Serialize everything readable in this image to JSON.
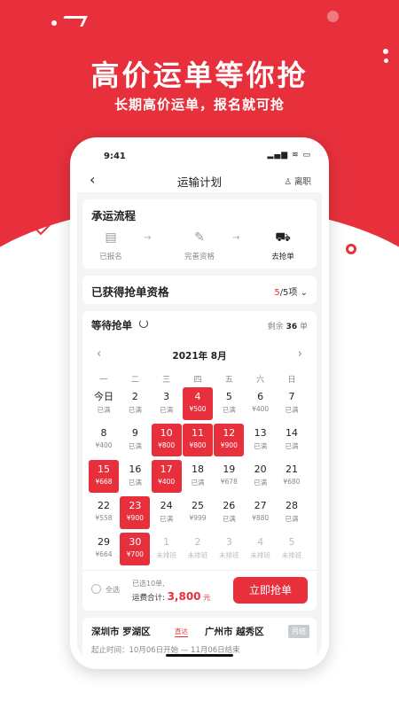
{
  "promo": {
    "title": "高价运单等你抢",
    "subtitle": "长期高价运单，报名就可抢"
  },
  "status_bar": {
    "time": "9:41",
    "icons": "▂▄▆ ≋ ▭"
  },
  "nav": {
    "back_icon": "‹",
    "title": "运输计划",
    "resign_label": "♙ 离职"
  },
  "flow": {
    "title": "承运流程",
    "steps": [
      {
        "label": "已报名",
        "icon": "▤"
      },
      {
        "label": "完善资格",
        "icon": "✎"
      },
      {
        "label": "去抢单",
        "icon": "⛟"
      }
    ],
    "arrow": "→"
  },
  "qualification": {
    "title": "已获得抢单资格",
    "count": "5",
    "total_suffix": "/5项",
    "chevron": "⌄"
  },
  "calendar": {
    "title": "等待抢单",
    "remain_prefix": "剩余",
    "remain_count": "36",
    "remain_suffix": "单",
    "month": "2021年 8月",
    "prev": "‹",
    "next": "›",
    "weekdays": [
      "一",
      "二",
      "三",
      "四",
      "五",
      "六",
      "日"
    ],
    "days": [
      {
        "d": "今日",
        "s": "已满",
        "state": "normal"
      },
      {
        "d": "2",
        "s": "已满",
        "state": "normal"
      },
      {
        "d": "3",
        "s": "已满",
        "state": "normal"
      },
      {
        "d": "4",
        "s": "¥500",
        "state": "sel"
      },
      {
        "d": "5",
        "s": "已满",
        "state": "normal"
      },
      {
        "d": "6",
        "s": "¥400",
        "state": "normal"
      },
      {
        "d": "7",
        "s": "已满",
        "state": "normal"
      },
      {
        "d": "8",
        "s": "¥400",
        "state": "normal"
      },
      {
        "d": "9",
        "s": "已满",
        "state": "normal"
      },
      {
        "d": "10",
        "s": "¥800",
        "state": "sel"
      },
      {
        "d": "11",
        "s": "¥800",
        "state": "sel"
      },
      {
        "d": "12",
        "s": "¥900",
        "state": "sel"
      },
      {
        "d": "13",
        "s": "已满",
        "state": "normal"
      },
      {
        "d": "14",
        "s": "已满",
        "state": "normal"
      },
      {
        "d": "15",
        "s": "¥668",
        "state": "sel"
      },
      {
        "d": "16",
        "s": "已满",
        "state": "normal"
      },
      {
        "d": "17",
        "s": "¥400",
        "state": "sel"
      },
      {
        "d": "18",
        "s": "已满",
        "state": "normal"
      },
      {
        "d": "19",
        "s": "¥678",
        "state": "normal"
      },
      {
        "d": "20",
        "s": "已满",
        "state": "normal"
      },
      {
        "d": "21",
        "s": "¥680",
        "state": "normal"
      },
      {
        "d": "22",
        "s": "¥558",
        "state": "normal"
      },
      {
        "d": "23",
        "s": "¥900",
        "state": "sel"
      },
      {
        "d": "24",
        "s": "已满",
        "state": "normal"
      },
      {
        "d": "25",
        "s": "¥999",
        "state": "normal"
      },
      {
        "d": "26",
        "s": "已满",
        "state": "normal"
      },
      {
        "d": "27",
        "s": "¥880",
        "state": "normal"
      },
      {
        "d": "28",
        "s": "已满",
        "state": "normal"
      },
      {
        "d": "29",
        "s": "¥664",
        "state": "normal"
      },
      {
        "d": "30",
        "s": "¥700",
        "state": "sel"
      },
      {
        "d": "1",
        "s": "未排班",
        "state": "off"
      },
      {
        "d": "2",
        "s": "未排班",
        "state": "off"
      },
      {
        "d": "3",
        "s": "未排班",
        "state": "off"
      },
      {
        "d": "4",
        "s": "未排班",
        "state": "off"
      },
      {
        "d": "5",
        "s": "未排班",
        "state": "off"
      }
    ]
  },
  "footer": {
    "select_all": "全选",
    "selected_text": "已选10单,",
    "total_label": "运费合计:",
    "total_amount": "3,800",
    "yuan": "元",
    "grab_button": "立即抢单"
  },
  "route": {
    "from": "深圳市 罗湖区",
    "direct": "直达",
    "to": "广州市 越秀区",
    "tag": "月结",
    "time": "起止时间：10月06日开始 — 11月06日结束"
  },
  "colors": {
    "brand_red": "#e8303d"
  }
}
